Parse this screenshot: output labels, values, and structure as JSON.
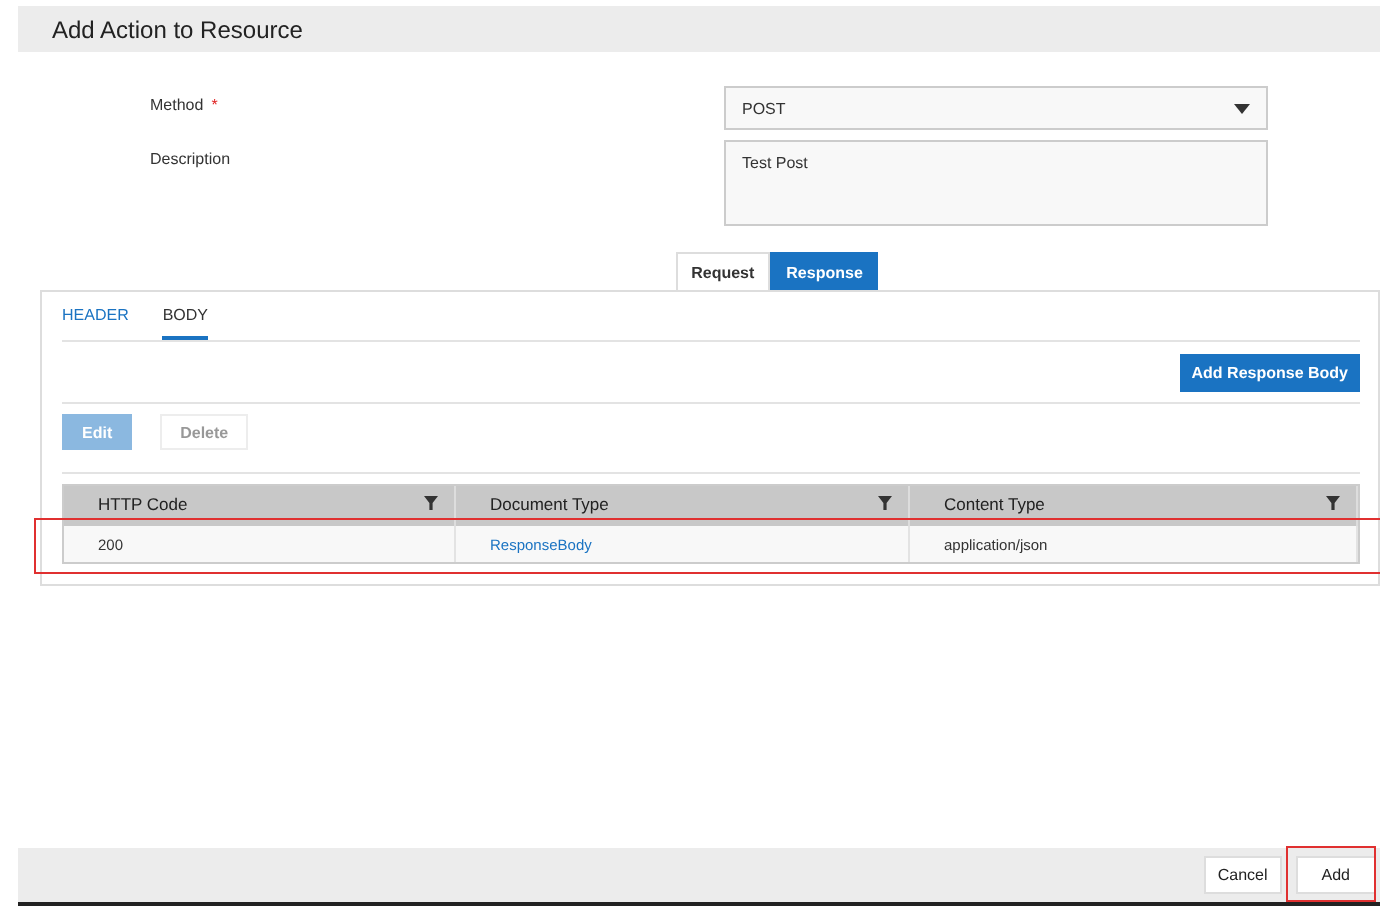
{
  "dialog": {
    "title": "Add Action to Resource"
  },
  "form": [
    {
      "label": "Method",
      "required_mark": "*",
      "kind": "select",
      "value": "POST"
    },
    {
      "label": "Description",
      "kind": "textarea",
      "value": "Test Post"
    }
  ],
  "tabs": [
    {
      "label": "Request",
      "selected": false
    },
    {
      "label": "Response",
      "selected": true
    }
  ],
  "subtabs": [
    {
      "label": "HEADER",
      "selected": false
    },
    {
      "label": "BODY",
      "selected": true
    }
  ],
  "add_button": "Add Response Body",
  "actions": [
    {
      "label": "Edit",
      "disabled": true,
      "kind": "primary"
    },
    {
      "label": "Delete",
      "disabled": true,
      "kind": "plain"
    }
  ],
  "table": {
    "columns": [
      "HTTP Code",
      "Document Type",
      "Content Type"
    ],
    "rows": [
      [
        {
          "text": "200",
          "link": false
        },
        {
          "text": "ResponseBody",
          "link": true
        },
        {
          "text": "application/json",
          "link": false
        }
      ]
    ]
  },
  "footer": {
    "buttons": [
      "Cancel",
      "Add"
    ]
  }
}
